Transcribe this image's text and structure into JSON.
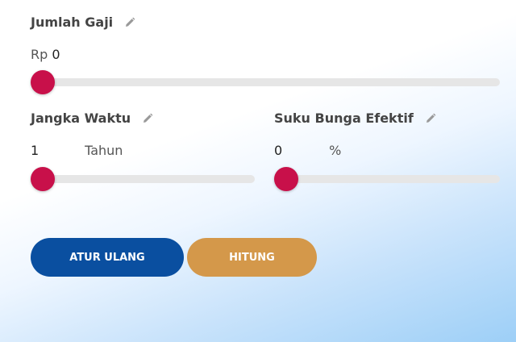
{
  "gaji": {
    "title": "Jumlah Gaji",
    "currency": "Rp",
    "value": "0",
    "slider_level": 0
  },
  "jangka": {
    "title": "Jangka Waktu",
    "value": "1",
    "unit": "Tahun",
    "slider_level": 0
  },
  "suku": {
    "title": "Suku Bunga Efektif",
    "value": "0",
    "unit": "%",
    "slider_level": 0
  },
  "buttons": {
    "reset_label": "ATUR ULANG",
    "calc_label": "HITUNG"
  },
  "colors": {
    "thumb": "#c8104a",
    "reset_button": "#0a4fa0",
    "calc_button": "#d4984a"
  },
  "icons": {
    "edit": "pencil-icon"
  }
}
